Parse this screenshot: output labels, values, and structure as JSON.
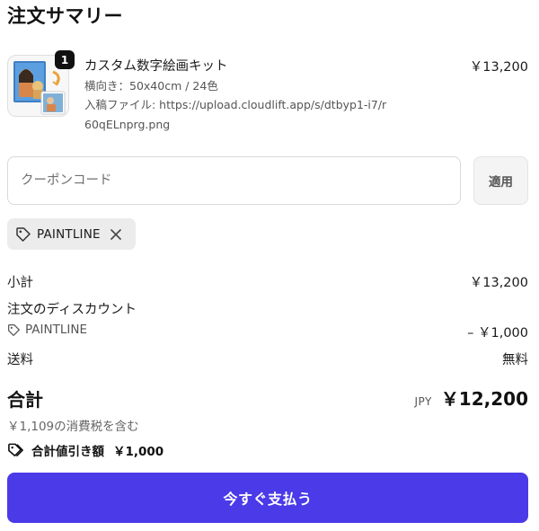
{
  "summary": {
    "title": "注文サマリー"
  },
  "line_item": {
    "quantity": "1",
    "name": "カスタム数字絵画キット",
    "price": "￥13,200",
    "variant": "横向き：50x40cm / 24色",
    "file_line": "入稿ファイル: https://upload.cloudlift.app/s/dtbyp1-i7/r60qELnprg.png",
    "thumbnail_icon": "paint-by-number-photo"
  },
  "coupon": {
    "placeholder": "クーポンコード",
    "apply_label": "適用",
    "applied_code": "PAINTLINE"
  },
  "totals": {
    "subtotal_label": "小計",
    "subtotal_value": "￥13,200",
    "order_discount_label": "注文のディスカウント",
    "discount_code_label": "PAINTLINE",
    "discount_value": "– ￥1,000",
    "shipping_label": "送料",
    "shipping_value": "無料",
    "total_label": "合計",
    "currency": "JPY",
    "total_value": "￥12,200",
    "tax_note": "￥1,109の消費税を含む",
    "savings_label": "合計値引き額",
    "savings_value": "￥1,000"
  },
  "actions": {
    "pay_now_label": "今すぐ支払う"
  },
  "colors": {
    "accent": "#4a3ae8",
    "chip_bg": "#ececec",
    "border": "#d9d9d9"
  }
}
